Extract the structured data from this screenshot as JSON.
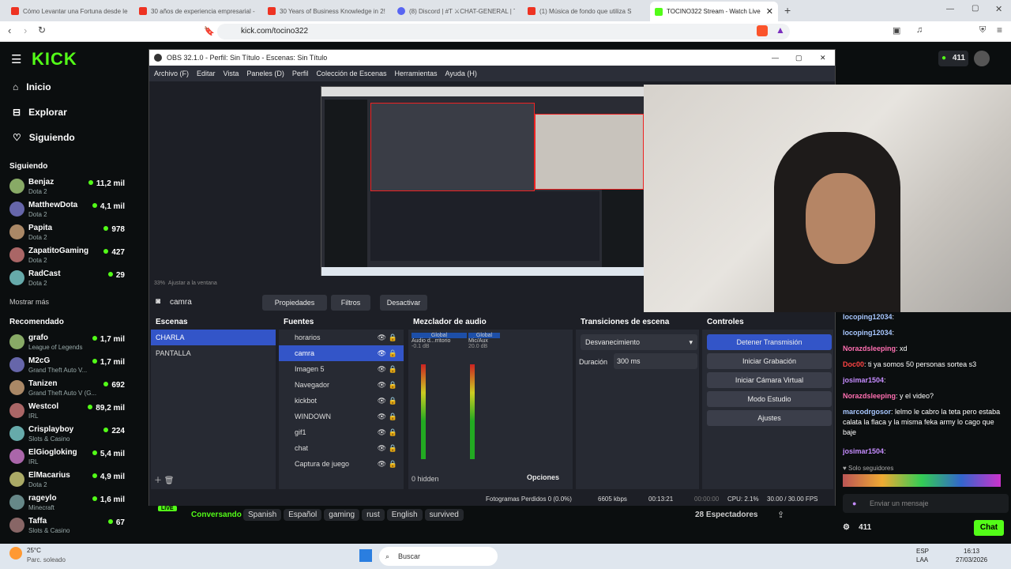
{
  "browser": {
    "tabs": [
      "Cómo Levantar una Fortuna desde le",
      "30 años de experiencia empresarial - Y",
      "30 Years of Business Knowledge in 2!",
      "(8) Discord | #T ⚔CHAT-GENERAL | TO",
      "(1) Música de fondo que utiliza S",
      "TOCINO322 Stream - Watch Live"
    ],
    "url": "kick.com/tocino322"
  },
  "kick": {
    "logo": "KICK",
    "nav": [
      "Inicio",
      "Explorar",
      "Siguiendo"
    ],
    "following_title": "Siguiendo",
    "following": [
      {
        "name": "Benjaz",
        "game": "Dota 2",
        "viewers": "11,2 mil"
      },
      {
        "name": "MatthewDota",
        "game": "Dota 2",
        "viewers": "4,1 mil"
      },
      {
        "name": "Papita",
        "game": "Dota 2",
        "viewers": "978"
      },
      {
        "name": "ZapatitoGaming",
        "game": "Dota 2",
        "viewers": "427"
      },
      {
        "name": "RadCast",
        "game": "Dota 2",
        "viewers": "29"
      }
    ],
    "show_more": "Mostrar más",
    "recommended_title": "Recomendado",
    "recommended": [
      {
        "name": "grafo",
        "game": "League of Legends",
        "viewers": "1,7 mil"
      },
      {
        "name": "M2cG",
        "game": "Grand Theft Auto V...",
        "viewers": "1,7 mil"
      },
      {
        "name": "Tanizen",
        "game": "Grand Theft Auto V (G...",
        "viewers": "692"
      },
      {
        "name": "Westcol",
        "game": "IRL",
        "viewers": "89,2 mil"
      },
      {
        "name": "Crisplayboy",
        "game": "Slots & Casino",
        "viewers": "224"
      },
      {
        "name": "ElGiogloking",
        "game": "IRL",
        "viewers": "5,4 mil"
      },
      {
        "name": "ElMacarius",
        "game": "Dota 2",
        "viewers": "4,9 mil"
      },
      {
        "name": "rageylo",
        "game": "Minecraft",
        "viewers": "1,6 mil"
      },
      {
        "name": "Taffa",
        "game": "Slots & Casino",
        "viewers": "67"
      }
    ],
    "top_count": "411",
    "live": "LIVE",
    "category": "Conversando",
    "tags": [
      "Spanish",
      "Español",
      "gaming",
      "rust",
      "English",
      "survived"
    ],
    "spectators": "28 Espectadores",
    "chat_placeholder": "Enviar un mensaje",
    "chat_btn": "Chat",
    "bottom_count": "411",
    "followers_only": "Solo seguidores"
  },
  "obs": {
    "title": "OBS 32.1.0 - Perfil: Sin Título - Escenas: Sin Título",
    "menu": [
      "Archivo (F)",
      "Editar",
      "Vista",
      "Paneles (D)",
      "Perfil",
      "Colección de Escenas",
      "Herramientas",
      "Ayuda (H)"
    ],
    "zoom": "33%",
    "fit": "Ajustar a la ventana",
    "source_name": "camra",
    "btn_props": "Propiedades",
    "btn_filters": "Filtros",
    "btn_deact": "Desactivar",
    "scenes_title": "Escenas",
    "scenes": [
      "CHARLA",
      "PANTALLA"
    ],
    "sources_title": "Fuentes",
    "sources": [
      "horarios",
      "camra",
      "Imagen 5",
      "Navegador",
      "kickbot",
      "WINDOWN",
      "gif1",
      "chat",
      "Captura de juego"
    ],
    "mixer_title": "Mezclador de audio",
    "mix": [
      {
        "label": "Global",
        "name": "Audio d...rritorio",
        "db": "-0.1 dB"
      },
      {
        "label": "Global",
        "name": "Mic/Aux",
        "db": "20.0 dB"
      }
    ],
    "hidden": "0 hidden",
    "advanced": "Opciones",
    "trans_title": "Transiciones de escena",
    "transition": "Desvanecimiento",
    "duration_label": "Duración",
    "duration": "300 ms",
    "controls_title": "Controles",
    "controls": [
      "Detener Transmisión",
      "Iniciar Grabación",
      "Iniciar Cámara Virtual",
      "Modo Estudio",
      "Ajustes"
    ],
    "status": {
      "dropped": "Fotogramas Perdidos 0 (0.0%)",
      "kbps": "6605 kbps",
      "time": "00:13:21",
      "rec": "00:00:00",
      "cpu": "CPU: 2.1%",
      "fps": "30.00 / 30.00 FPS"
    }
  },
  "chat": [
    {
      "user": "locoping12034",
      "text": "",
      "color": "#a8c7ff"
    },
    {
      "user": "locoping12034",
      "text": "",
      "color": "#a8c7ff"
    },
    {
      "user": "Norazdsleeping",
      "text": "xd",
      "color": "#ff6fb1"
    },
    {
      "user": "Doc00",
      "text": "ti ya somos 50 personas sortea s3",
      "color": "#ff4444"
    },
    {
      "user": "josimar1504",
      "text": "",
      "color": "#c58cff"
    },
    {
      "user": "Norazdsleeping",
      "text": "y el video?",
      "color": "#ff6fb1"
    },
    {
      "user": "marcodrgosor",
      "text": "lelmo le cabro la teta pero estaba calata la flaca y la misma feka army lo cago que baje",
      "color": "#a8c7ff"
    },
    {
      "user": "josimar1504",
      "text": "",
      "color": "#c58cff"
    }
  ],
  "taskbar": {
    "weather": "25°C",
    "weather2": "Parc. soleado",
    "search": "Buscar",
    "lang": "ESP",
    "lang2": "LAA",
    "time": "16:13",
    "date": "27/03/2026"
  }
}
